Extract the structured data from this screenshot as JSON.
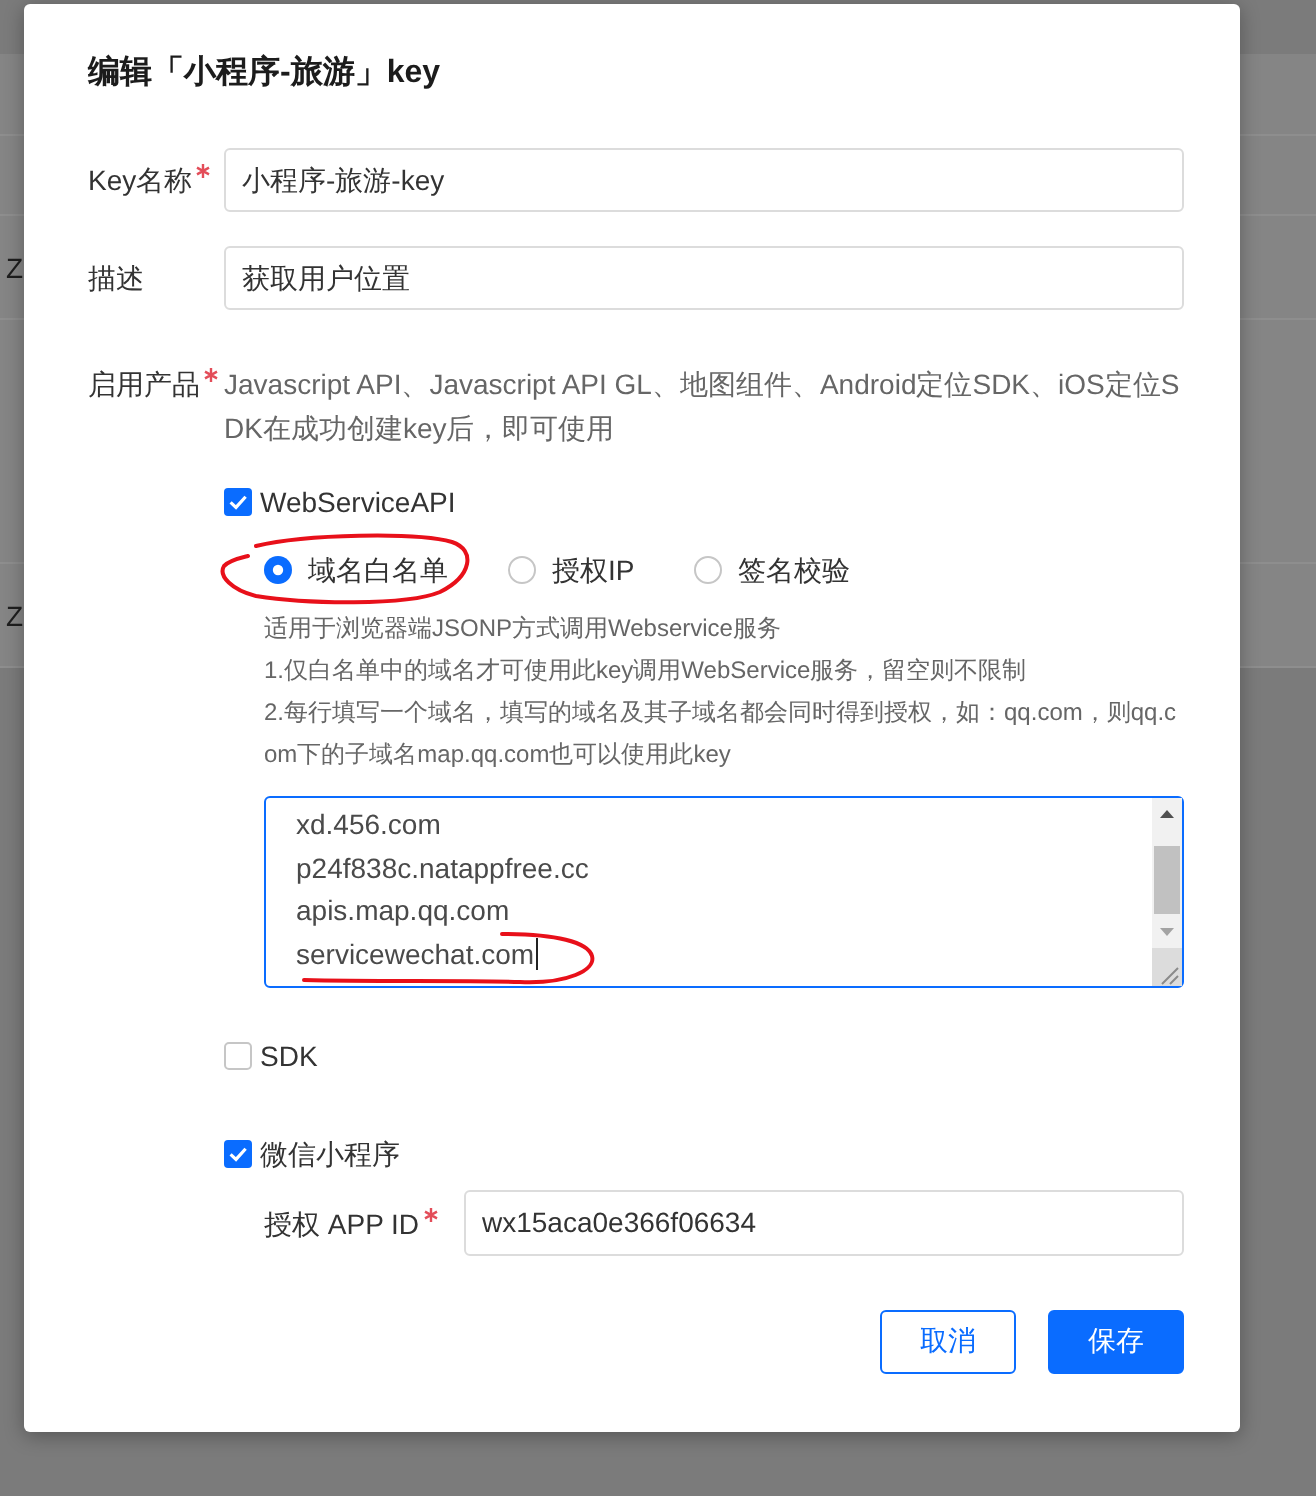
{
  "background_table": {
    "rows": [
      {
        "column_1": "Z"
      },
      {
        "column_1": "Z"
      }
    ]
  },
  "dialog": {
    "title": "编辑「小程序-旅游」key",
    "fields": [
      {
        "kind": "input",
        "label": "Key名称",
        "required": true,
        "value": "小程序-旅游-key"
      },
      {
        "kind": "input",
        "label": "描述",
        "required": false,
        "value": "获取用户位置"
      }
    ],
    "products": {
      "label": "启用产品",
      "required": true,
      "description": "Javascript API、Javascript API GL、地图组件、Android定位SDK、iOS定位SDK在成功创建key后，即可使用",
      "items": [
        {
          "kind": "webservice",
          "label": "WebServiceAPI",
          "checked": true,
          "auth_modes": [
            {
              "label": "域名白名单",
              "selected": true,
              "circled": true
            },
            {
              "label": "授权IP",
              "selected": false,
              "circled": false
            },
            {
              "label": "签名校验",
              "selected": false,
              "circled": false
            }
          ],
          "hints": [
            "适用于浏览器端JSONP方式调用Webservice服务",
            "1.仅白名单中的域名才可使用此key调用WebService服务，留空则不限制",
            "2.每行填写一个域名，填写的域名及其子域名都会同时得到授权，如：qq.com，则qq.com下的子域名map.qq.com也可以使用此key"
          ],
          "domains": {
            "focused": true,
            "lines": [
              {
                "text": "xd.456.com",
                "underlined": false
              },
              {
                "text": "p24f838c.natappfree.cc",
                "underlined": false
              },
              {
                "text": "apis.map.qq.com",
                "underlined": false
              },
              {
                "text": "servicewechat.com",
                "underlined": true
              }
            ]
          }
        },
        {
          "kind": "plain",
          "label": "SDK",
          "checked": false
        },
        {
          "kind": "miniprogram",
          "label": "微信小程序",
          "checked": true,
          "app_id": {
            "label": "授权 APP ID",
            "required": true,
            "value": "wx15aca0e366f06634"
          }
        }
      ]
    },
    "buttons": [
      {
        "kind": "cancel",
        "label": "取消"
      },
      {
        "kind": "save",
        "label": "保存"
      }
    ]
  }
}
